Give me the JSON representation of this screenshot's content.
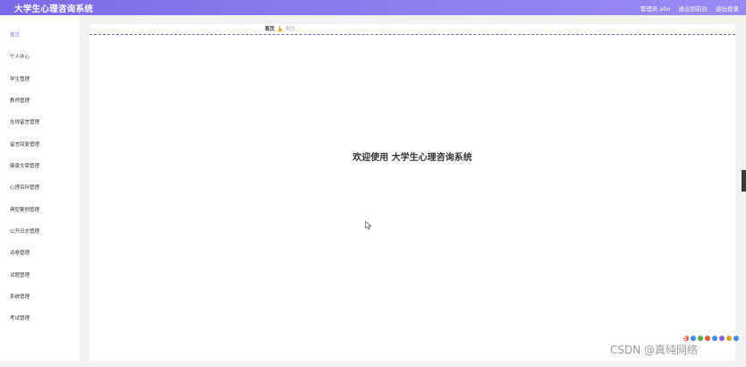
{
  "header": {
    "title": "大学生心理咨询系统",
    "admin_label": "管理员 abo",
    "exit_console": "退出到前台",
    "logout": "退出登录",
    "gradient_colors": [
      "#7c6ae8",
      "#9a8af4"
    ]
  },
  "sidebar": {
    "items": [
      {
        "label": "首页",
        "active": true
      },
      {
        "label": "个人中心"
      },
      {
        "label": "学生管理"
      },
      {
        "label": "教师管理"
      },
      {
        "label": "在线留言管理"
      },
      {
        "label": "留言回复管理"
      },
      {
        "label": "健康文章管理"
      },
      {
        "label": "心理百科管理"
      },
      {
        "label": "典型案例管理"
      },
      {
        "label": "公开日志管理"
      },
      {
        "label": "试卷管理"
      },
      {
        "label": "试题管理"
      },
      {
        "label": "系统管理"
      },
      {
        "label": "考试管理"
      }
    ]
  },
  "breadcrumb": {
    "home": "首页",
    "icon": "hand-icon",
    "current": "首页"
  },
  "main": {
    "welcome": "欢迎使用 大学生心理咨询系统"
  },
  "watermark": {
    "text": "CSDN @真纯网络"
  },
  "colors": {
    "accent": "#7e6bea",
    "background": "#f2f2f2",
    "dashed_line": "#6a6ad0"
  }
}
